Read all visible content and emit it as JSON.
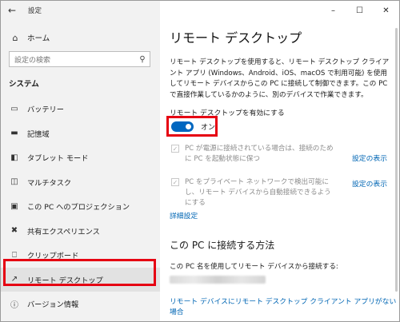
{
  "window": {
    "title": "設定"
  },
  "sidebar": {
    "home_label": "ホーム",
    "search_placeholder": "設定の検索",
    "section_title": "システム",
    "items": [
      {
        "label": "バッテリー",
        "icon": "battery-icon"
      },
      {
        "label": "記憶域",
        "icon": "storage-icon"
      },
      {
        "label": "タブレット モード",
        "icon": "tablet-mode-icon"
      },
      {
        "label": "マルチタスク",
        "icon": "multitasking-icon"
      },
      {
        "label": "この PC へのプロジェクション",
        "icon": "projection-icon"
      },
      {
        "label": "共有エクスペリエンス",
        "icon": "shared-experience-icon"
      },
      {
        "label": "クリップボード",
        "icon": "clipboard-icon"
      },
      {
        "label": "リモート デスクトップ",
        "icon": "remote-desktop-icon",
        "selected": true
      },
      {
        "label": "バージョン情報",
        "icon": "info-icon"
      }
    ]
  },
  "main": {
    "title": "リモート デスクトップ",
    "description": "リモート デスクトップを使用すると、リモート デスクトップ クライアント アプリ (Windows、Android、iOS、macOS で利用可能) を使用してリモート デバイスからこの PC に接続して制御できます。この PC で直接作業しているかのように、別のデバイスで作業できます。",
    "enable_label": "リモート デスクトップを有効にする",
    "toggle": {
      "state_text": "オン",
      "on": true
    },
    "option1": {
      "text": "PC が電源に接続されている場合は、接続のために PC を起動状態に保つ",
      "link": "設定の表示",
      "checked": true,
      "disabled": true
    },
    "option2": {
      "text": "PC をプライベート ネットワークで検出可能にし、リモート デバイスから自動接続できるようにする",
      "link": "設定の表示",
      "checked": true,
      "disabled": true
    },
    "advanced_link": "詳細設定",
    "connect_heading": "この PC に接続する方法",
    "connect_label": "この PC 名を使用してリモート デバイスから接続する:",
    "no_client_link": "リモート デバイスにリモート デスクトップ クライアント アプリがない場合"
  },
  "colors": {
    "accent": "#0067c0",
    "highlight_box": "#e60012",
    "link": "#0066b4"
  }
}
